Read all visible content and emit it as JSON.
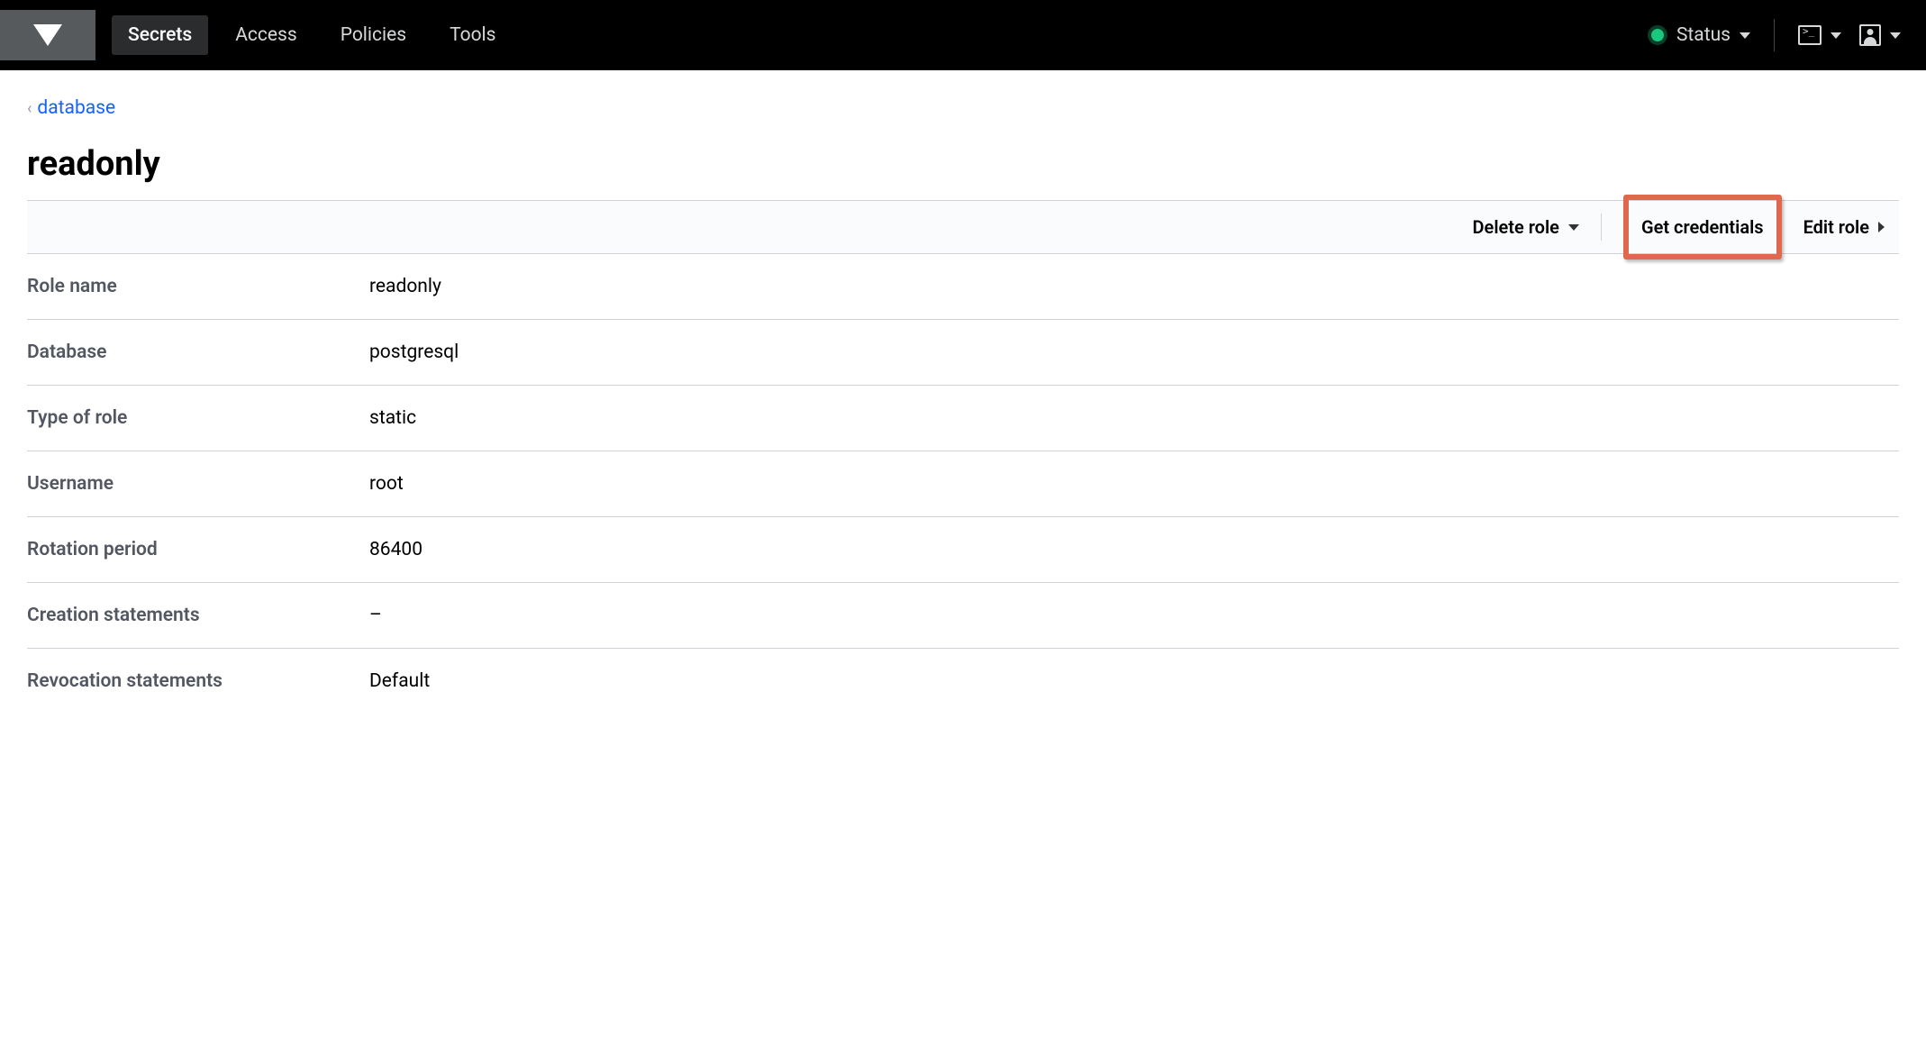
{
  "nav": {
    "items": [
      {
        "label": "Secrets",
        "active": true
      },
      {
        "label": "Access",
        "active": false
      },
      {
        "label": "Policies",
        "active": false
      },
      {
        "label": "Tools",
        "active": false
      }
    ],
    "status_label": "Status"
  },
  "breadcrumb": {
    "parent": "database"
  },
  "page": {
    "title": "readonly"
  },
  "toolbar": {
    "delete_label": "Delete role",
    "get_credentials_label": "Get credentials",
    "edit_label": "Edit role"
  },
  "details": [
    {
      "label": "Role name",
      "value": "readonly"
    },
    {
      "label": "Database",
      "value": "postgresql"
    },
    {
      "label": "Type of role",
      "value": "static"
    },
    {
      "label": "Username",
      "value": "root"
    },
    {
      "label": "Rotation period",
      "value": "86400"
    },
    {
      "label": "Creation statements",
      "value": "–"
    },
    {
      "label": "Revocation statements",
      "value": "Default"
    }
  ]
}
